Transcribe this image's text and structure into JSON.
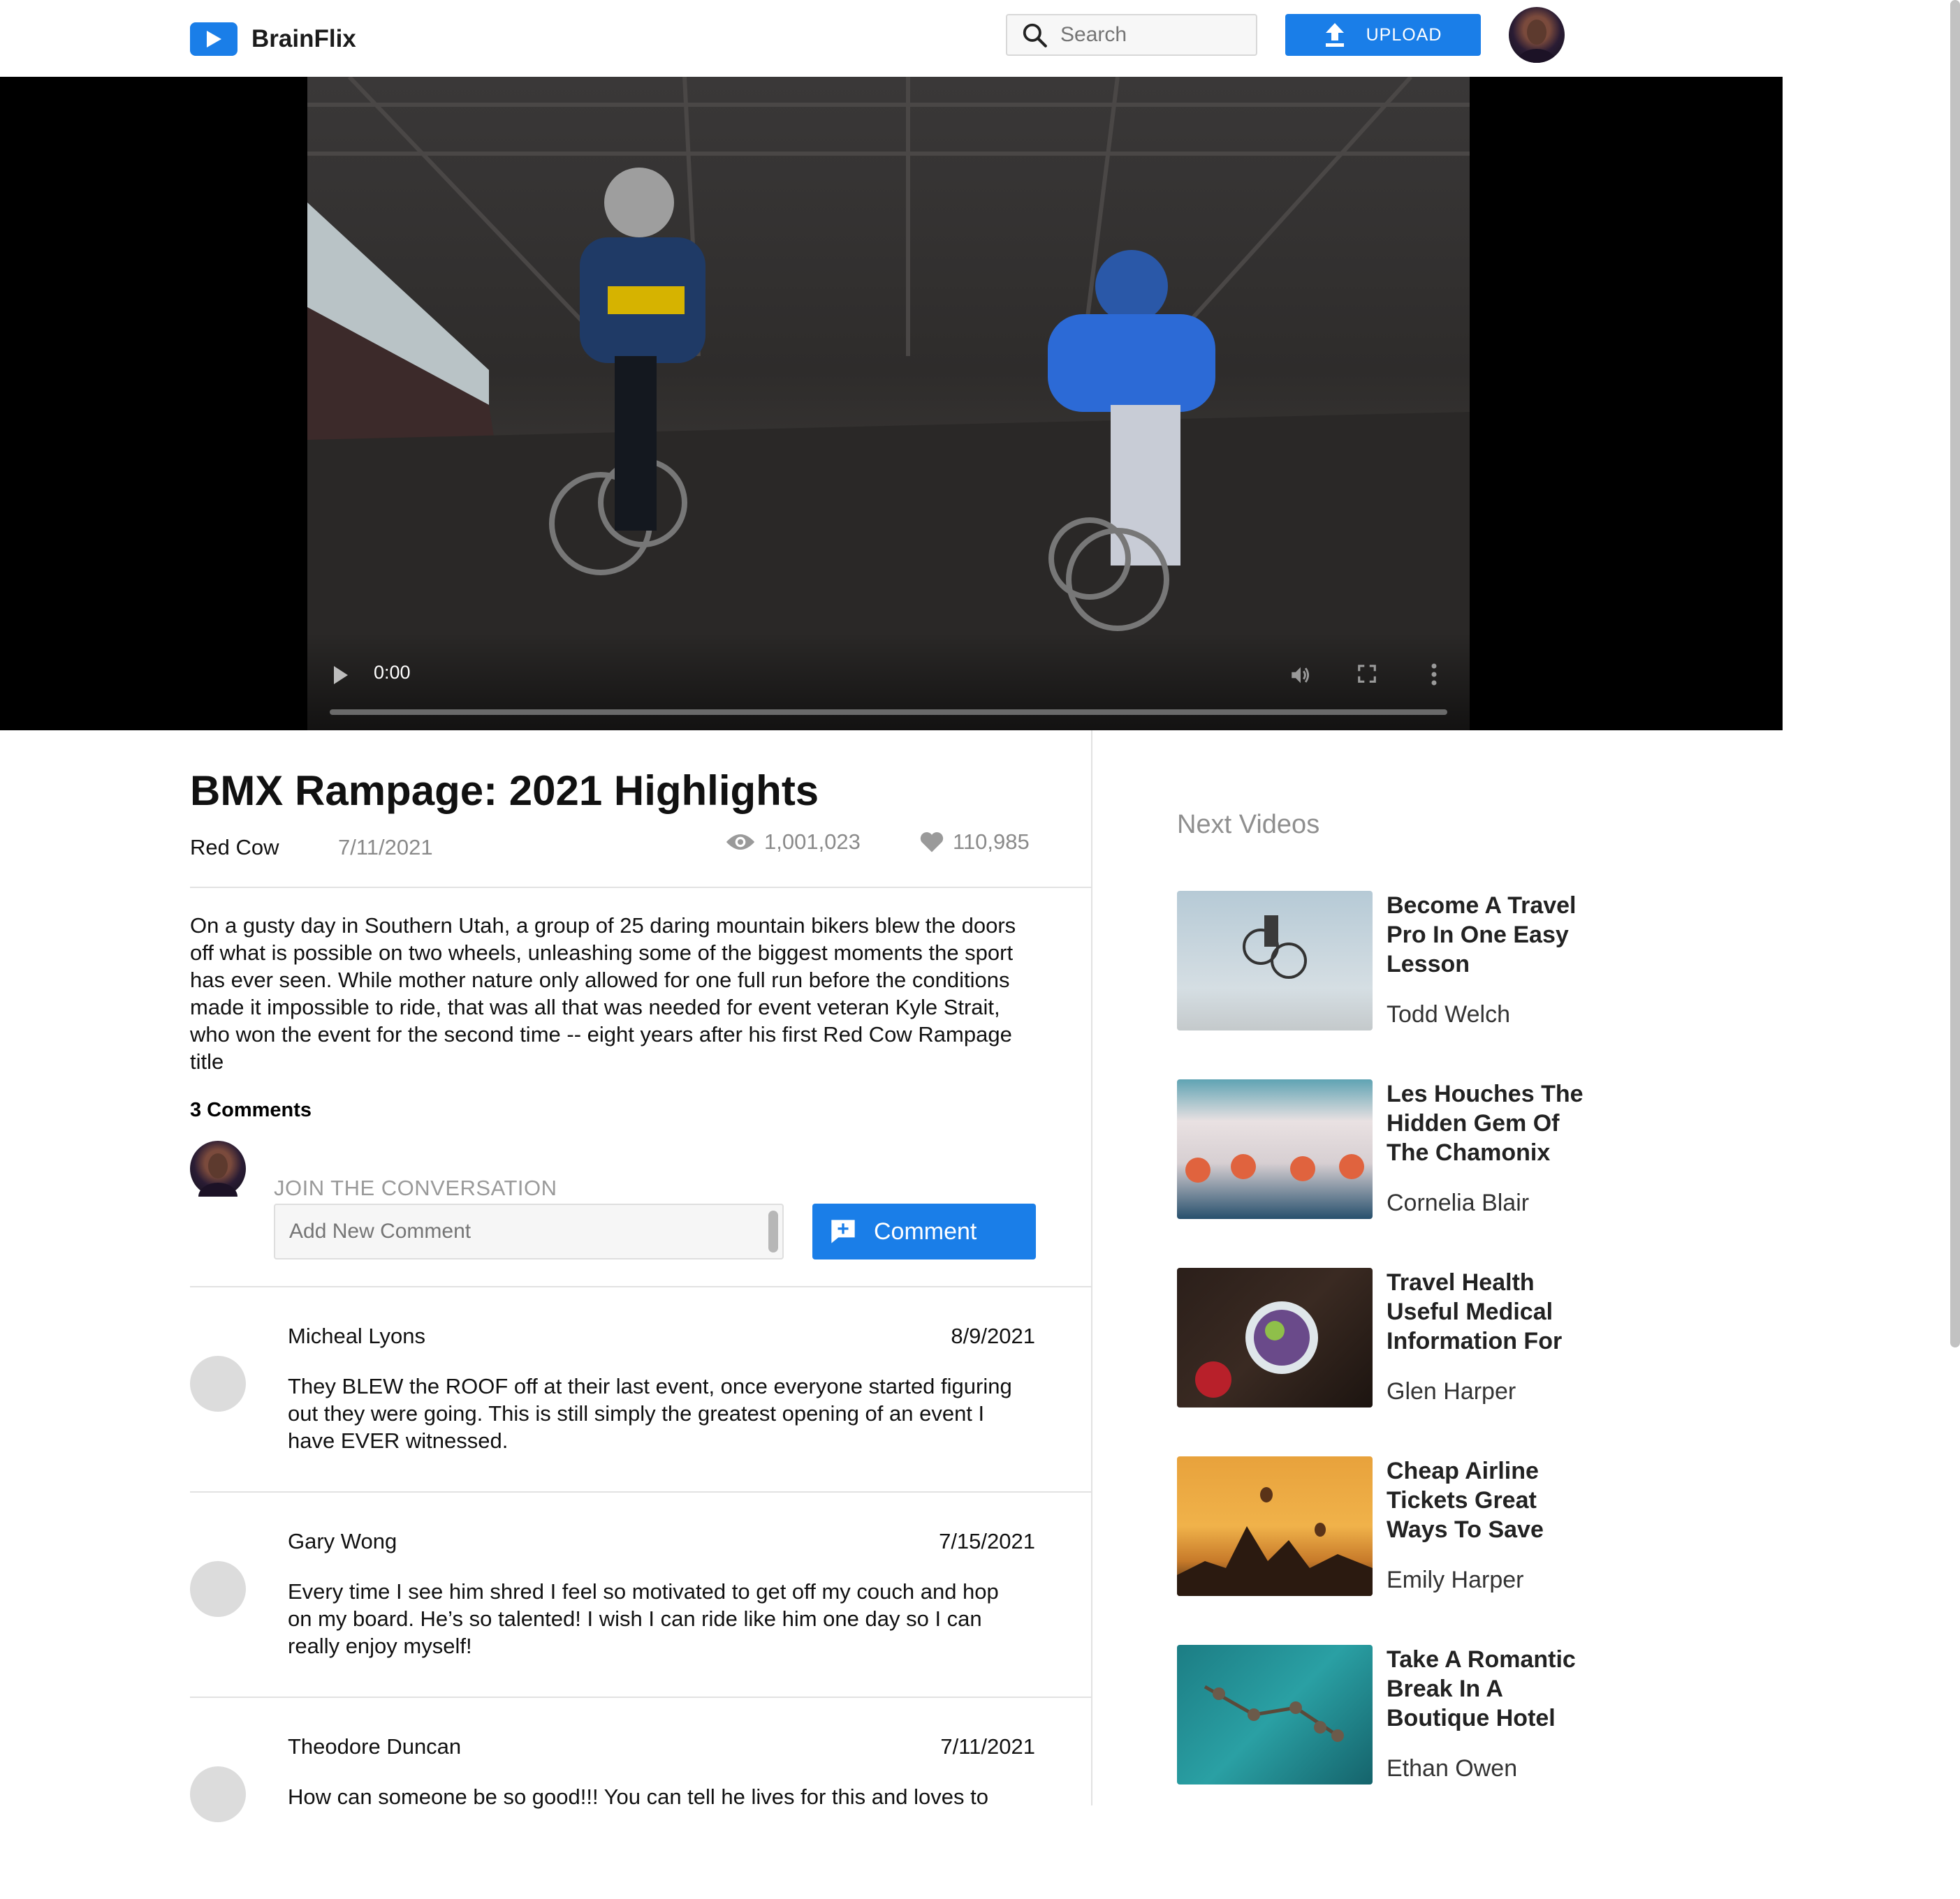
{
  "app": {
    "name": "BrainFlix"
  },
  "header": {
    "search_placeholder": "Search",
    "upload_label": "UPLOAD",
    "icons": {
      "logo": "play-icon",
      "search": "search-icon",
      "upload": "upload-icon"
    }
  },
  "player": {
    "current_time": "0:00",
    "progress": 0,
    "icons": [
      "play-icon",
      "volume-icon",
      "fullscreen-icon",
      "more-icon"
    ]
  },
  "video": {
    "title": "BMX Rampage: 2021 Highlights",
    "channel": "Red Cow",
    "date": "7/11/2021",
    "views": "1,001,023",
    "likes": "110,985",
    "description": "On a gusty day in Southern Utah, a group of 25 daring mountain bikers blew the doors off what is possible on two wheels, unleashing some of the biggest moments the sport has ever seen. While mother nature only allowed for one full run before the conditions made it impossible to ride, that was all that was needed for event veteran Kyle Strait, who won the event for the second time -- eight years after his first Red Cow Rampage title"
  },
  "comments": {
    "count_label": "3 Comments",
    "join_label": "JOIN THE CONVERSATION",
    "input_placeholder": "Add New Comment",
    "button_label": "Comment",
    "items": [
      {
        "name": "Micheal Lyons",
        "date": "8/9/2021",
        "text": "They BLEW the ROOF off at their last event, once everyone started figuring out they were going. This is still simply the greatest opening of an event I have EVER witnessed."
      },
      {
        "name": "Gary Wong",
        "date": "7/15/2021",
        "text": "Every time I see him shred I feel so motivated to get off my couch and hop on my board. He’s so talented! I wish I can ride like him one day so I can really enjoy myself!"
      },
      {
        "name": "Theodore Duncan",
        "date": "7/11/2021",
        "text": "How can someone be so good!!! You can tell he lives for this and loves to"
      }
    ]
  },
  "next_videos": {
    "heading": "Next Videos",
    "items": [
      {
        "title": "Become A Travel Pro In One Easy Lesson",
        "author": "Todd Welch"
      },
      {
        "title": "Les Houches The Hidden Gem Of The Chamonix",
        "author": "Cornelia Blair"
      },
      {
        "title": "Travel Health Useful Medical Information For",
        "author": "Glen Harper"
      },
      {
        "title": "Cheap Airline Tickets Great Ways To Save",
        "author": "Emily Harper"
      },
      {
        "title": "Take A Romantic Break In A Boutique Hotel",
        "author": "Ethan Owen"
      }
    ]
  },
  "colors": {
    "accent": "#1a7ee8",
    "muted_text": "#8a8a8a",
    "divider": "#e2e2e2"
  }
}
